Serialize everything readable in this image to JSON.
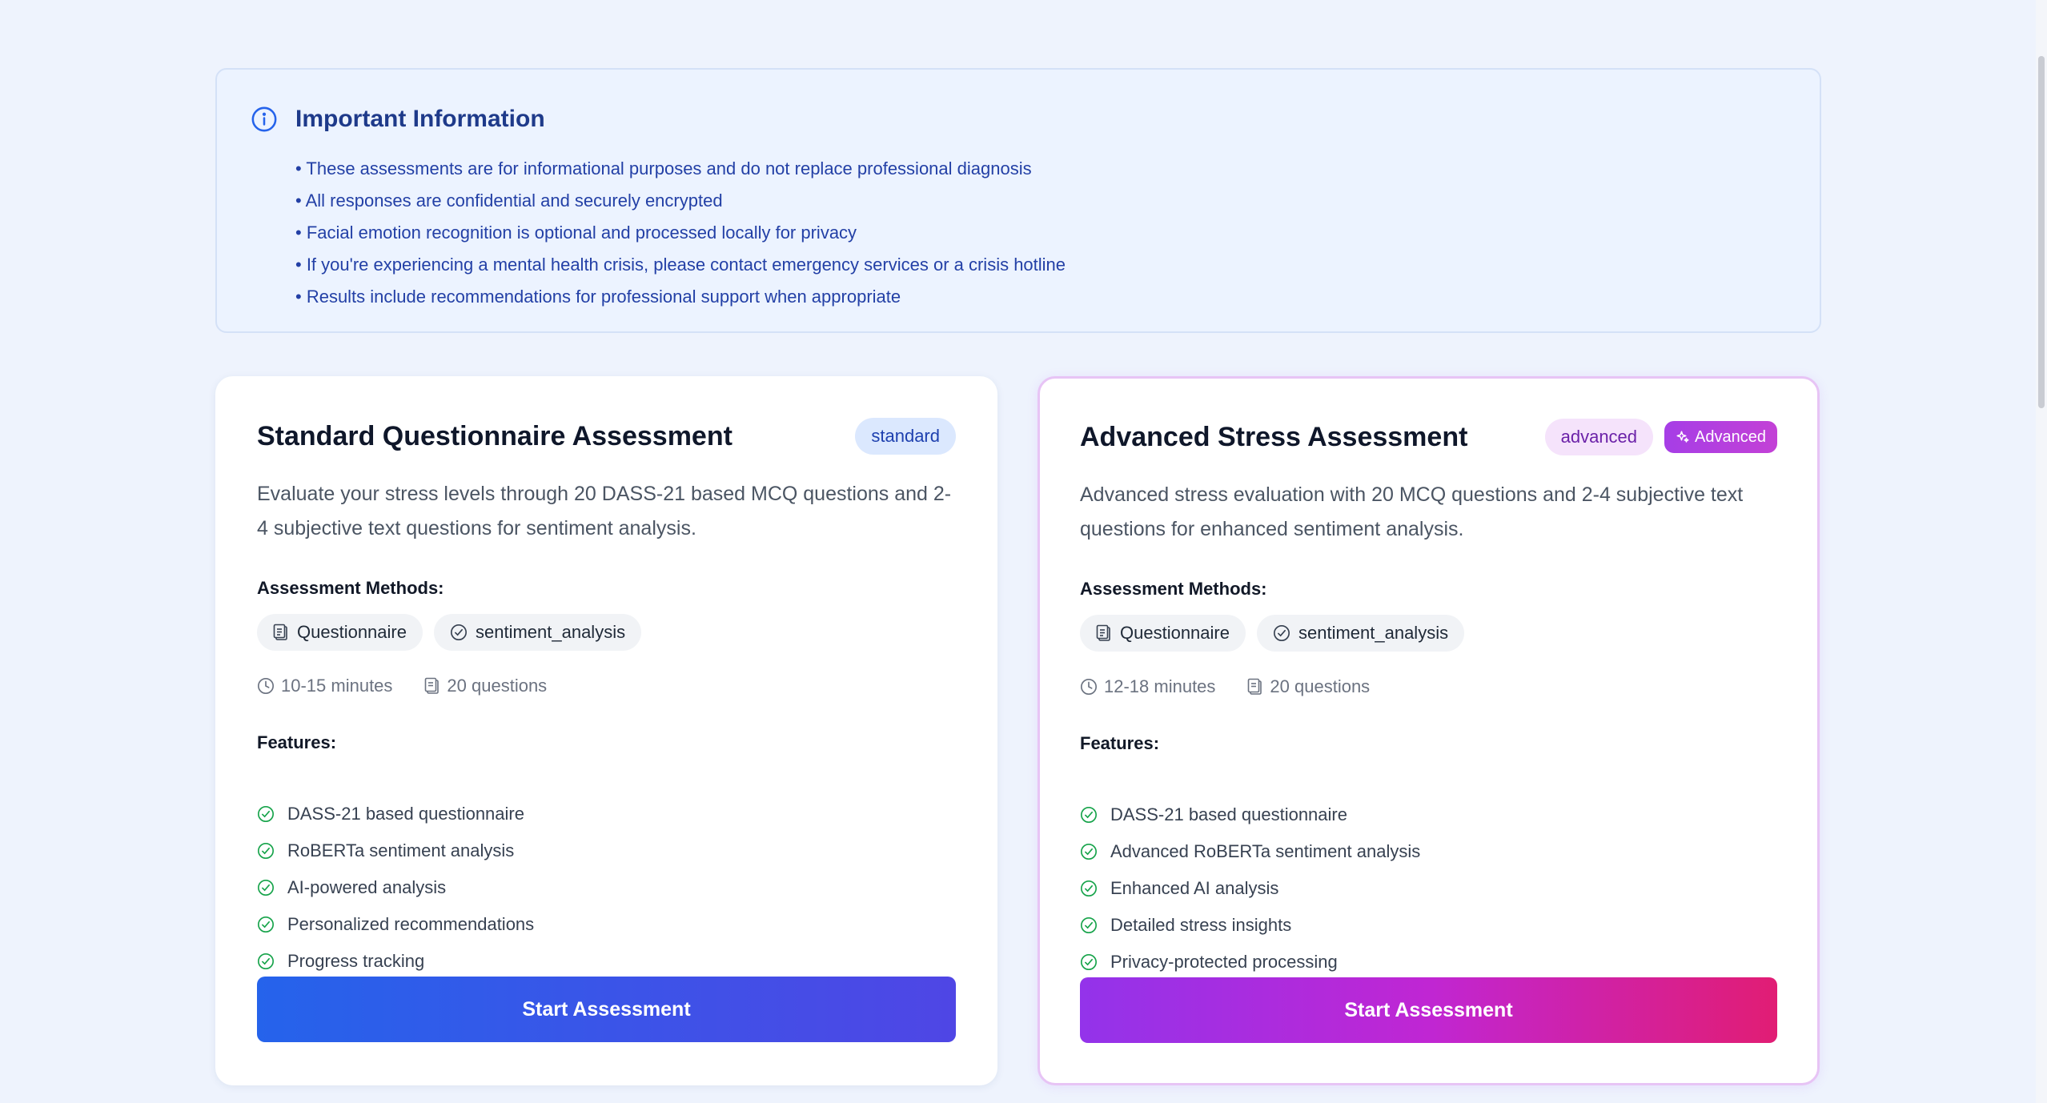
{
  "colors": {
    "background": "#eef3fd",
    "info_bg": "#ecf3ff",
    "info_text": "#2340a6",
    "check_green": "#16a34a",
    "standard_gradient": [
      "#2563eb",
      "#4f46e5"
    ],
    "advanced_gradient": [
      "#9333ea",
      "#c026d3",
      "#e11d74"
    ]
  },
  "info": {
    "icon": "info-circle-icon",
    "title": "Important Information",
    "items": [
      "• These assessments are for informational purposes and do not replace professional diagnosis",
      "• All responses are confidential and securely encrypted",
      "• Facial emotion recognition is optional and processed locally for privacy",
      "• If you're experiencing a mental health crisis, please contact emergency services or a crisis hotline",
      "• Results include recommendations for professional support when appropriate"
    ]
  },
  "cards": [
    {
      "title": "Standard Questionnaire Assessment",
      "badge": "standard",
      "description": "Evaluate your stress levels through 20 DASS-21 based MCQ questions and 2-4 subjective text questions for sentiment analysis.",
      "methods_label": "Assessment Methods:",
      "methods": [
        {
          "icon": "clipboard-icon",
          "label": "Questionnaire"
        },
        {
          "icon": "check-circle-icon",
          "label": "sentiment_analysis"
        }
      ],
      "duration": "10-15 minutes",
      "questions": "20 questions",
      "features_label": "Features:",
      "features": [
        "DASS-21 based questionnaire",
        "RoBERTa sentiment analysis",
        "AI-powered analysis",
        "Personalized recommendations",
        "Progress tracking"
      ],
      "button": "Start Assessment"
    },
    {
      "title": "Advanced Stress Assessment",
      "badge": "advanced",
      "extra_badge": "Advanced",
      "description": "Advanced stress evaluation with 20 MCQ questions and 2-4 subjective text questions for enhanced sentiment analysis.",
      "methods_label": "Assessment Methods:",
      "methods": [
        {
          "icon": "clipboard-icon",
          "label": "Questionnaire"
        },
        {
          "icon": "check-circle-icon",
          "label": "sentiment_analysis"
        }
      ],
      "duration": "12-18 minutes",
      "questions": "20 questions",
      "features_label": "Features:",
      "features": [
        "DASS-21 based questionnaire",
        "Advanced RoBERTa sentiment analysis",
        "Enhanced AI analysis",
        "Detailed stress insights",
        "Privacy-protected processing"
      ],
      "button": "Start Assessment"
    }
  ]
}
